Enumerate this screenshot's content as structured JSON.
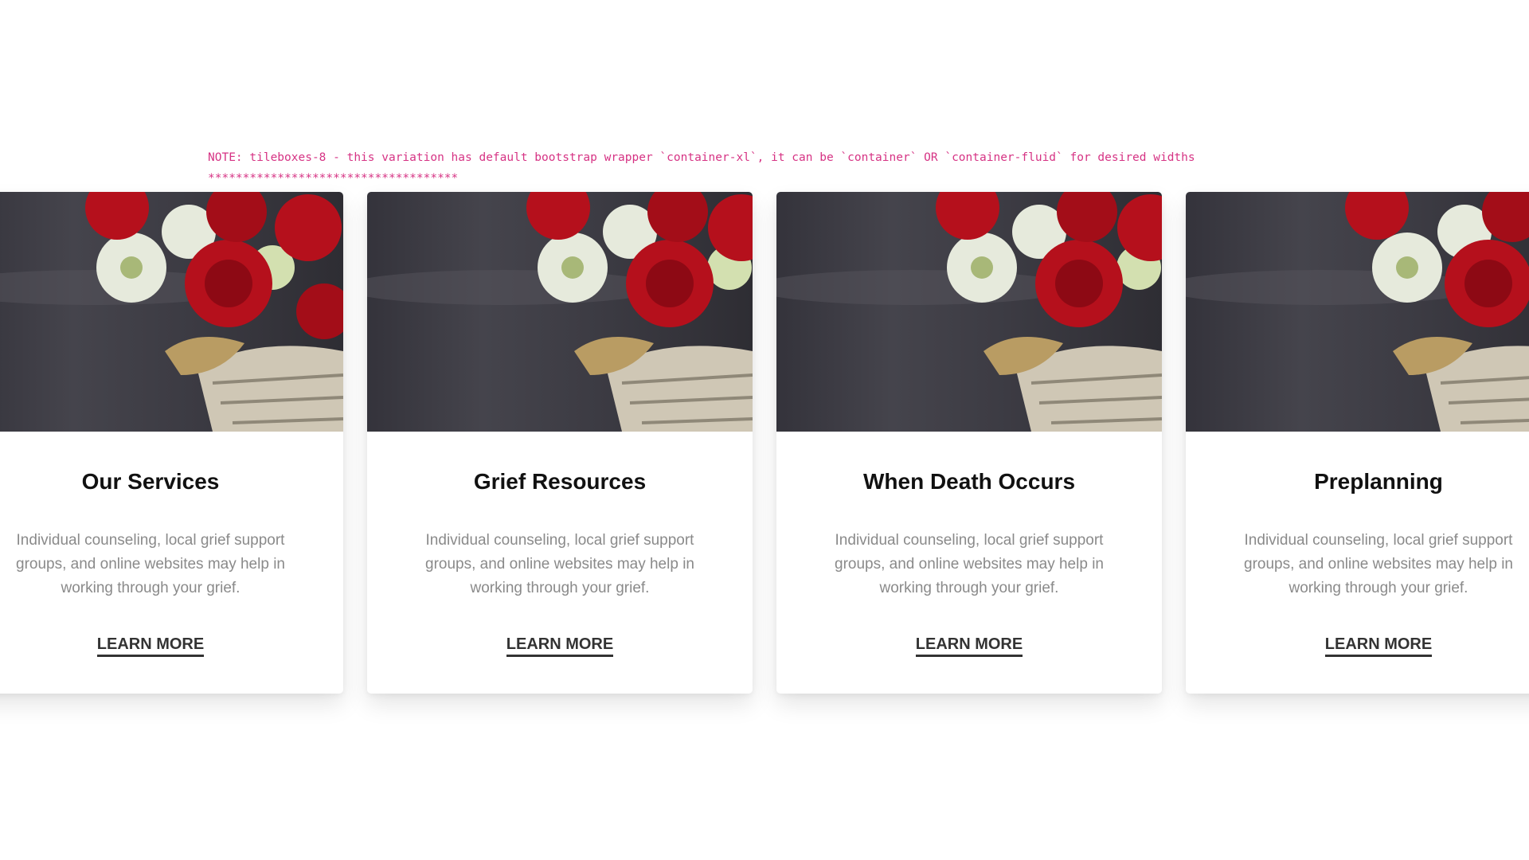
{
  "note": {
    "line1": "NOTE: tileboxes-8 - this variation has default bootstrap wrapper `container-xl`, it can be `container` OR `container-fluid` for desired widths",
    "line2": "************************************"
  },
  "cards": [
    {
      "title": "Our Services",
      "text": "Individual counseling, local grief support groups, and online websites may help in working through your grief.",
      "link": "LEARN MORE"
    },
    {
      "title": "Grief Resources",
      "text": "Individual counseling, local grief support groups, and online websites may help in working through your grief.",
      "link": "LEARN MORE"
    },
    {
      "title": "When Death Occurs",
      "text": "Individual counseling, local grief support groups, and online websites may help in working through your grief.",
      "link": "LEARN MORE"
    },
    {
      "title": "Preplanning",
      "text": "Individual counseling, local grief support groups, and online websites may help in working through your grief.",
      "link": "LEARN MORE"
    }
  ],
  "colors": {
    "note": "#d63384",
    "rose": "#b5101c",
    "chrysanthemum": "#e6eadc",
    "basket": "#cfc7b5"
  }
}
